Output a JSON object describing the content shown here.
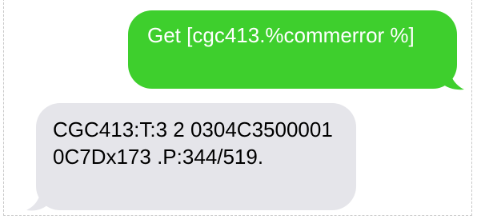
{
  "colors": {
    "sent_bubble": "#3ecf2d",
    "sent_text": "#ffffff",
    "received_bubble": "#e5e5ea",
    "received_text": "#000000"
  },
  "messages": [
    {
      "direction": "sent",
      "text": "Get [cgc413.%commerror %]"
    },
    {
      "direction": "received",
      "text": "CGC413:T:3 2 0304C35000010C7Dx173 .P:344/519."
    }
  ]
}
